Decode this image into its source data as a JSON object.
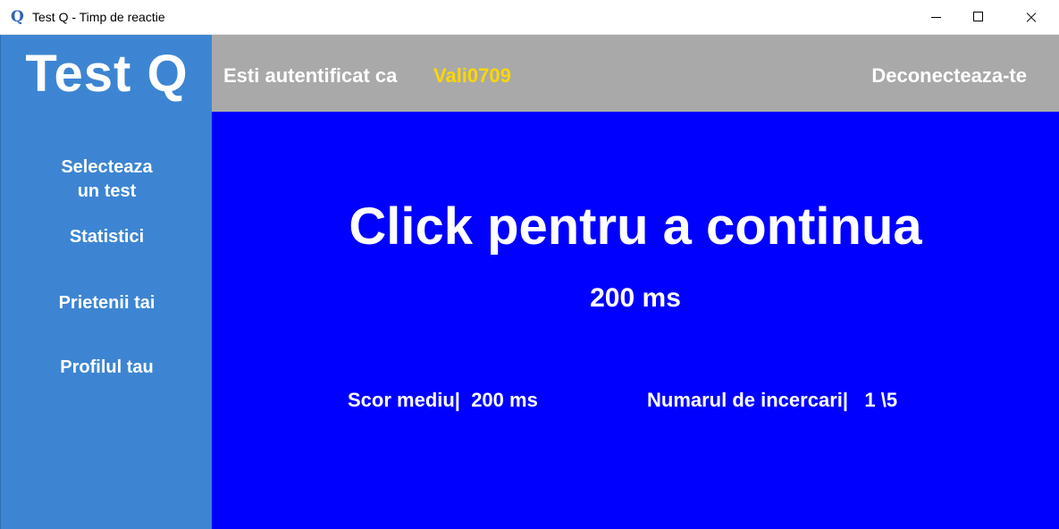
{
  "window": {
    "icon_glyph": "Q",
    "title": "Test Q - Timp de reactie"
  },
  "sidebar": {
    "logo": "Test Q",
    "items": [
      {
        "line1": "Selecteaza",
        "line2": "un test"
      },
      {
        "label": "Statistici"
      },
      {
        "label": "Prietenii tai"
      },
      {
        "label": "Profilul tau"
      }
    ]
  },
  "header": {
    "auth_label": "Esti autentificat ca",
    "username": "Vali0709",
    "logout_label": "Deconecteaza-te"
  },
  "main": {
    "headline": "Click pentru a continua",
    "result": "200 ms",
    "average_label": "Scor mediu|  200 ms",
    "attempts_label": "Numarul de incercari|   1 \\5"
  },
  "colors": {
    "sidebar": "#3d85d2",
    "topbar": "#a9a9a9",
    "main": "#0000ff",
    "username": "#ffd700"
  }
}
